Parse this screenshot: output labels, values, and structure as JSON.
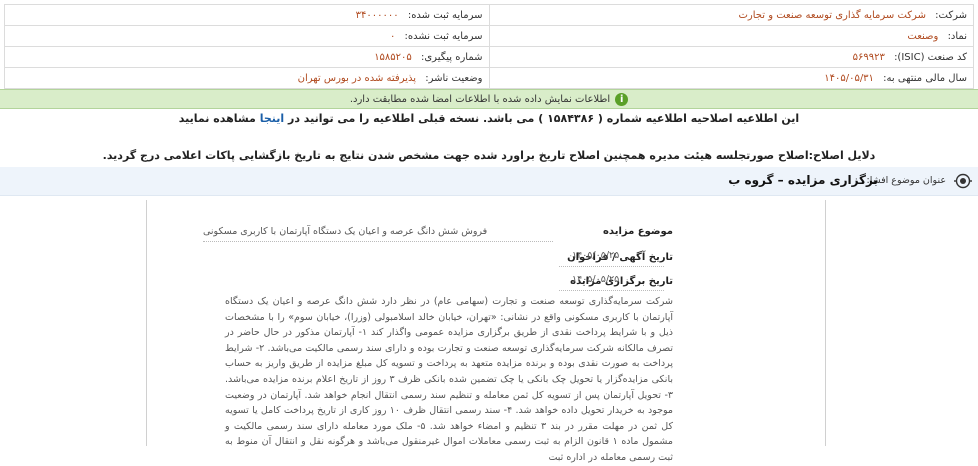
{
  "company_table": {
    "company_label": "شرکت:",
    "company_value": "شرکت سرمایه گذاری توسعه صنعت و تجارت",
    "registered_capital_label": "سرمایه ثبت شده:",
    "registered_capital_value": "۳۴۰۰۰۰۰۰",
    "symbol_label": "نماد:",
    "symbol_value": "وصنعت",
    "unregistered_capital_label": "سرمایه ثبت نشده:",
    "unregistered_capital_value": "۰",
    "isic_label": "کد صنعت (ISIC):",
    "isic_value": "۵۶۹۹۲۳",
    "tracking_label": "شماره پیگیری:",
    "tracking_value": "۱۵۸۵۲۰۵",
    "fiscal_label": "سال مالی منتهی به:",
    "fiscal_value": "۱۴۰۵/۰۵/۳۱",
    "status_label": "وضعیت ناشر:",
    "status_value": "پذیرفته شده در بورس تهران"
  },
  "notice": {
    "icon": "info-icon",
    "text": "اطلاعات نمایش داده شده با اطلاعات امضا شده مطابقت دارد."
  },
  "correction": {
    "line1_prefix": "این اطلاعیه اصلاحیه اطلاعیه شماره ( ۱۵۸۴۳۸۶ ) می باشد. نسخه قبلی اطلاعیه را می توانید در",
    "line1_link": "اینجا",
    "line1_suffix": "مشاهده نمایید",
    "line2": "دلایل اصلاح:اصلاح صورتجلسه هیئت مدیره همچنین اصلاح تاریخ براورد شده جهت مشخص شدن نتایج به تاریخ بازگشایی پاکات اعلامی درج گردید."
  },
  "subject": {
    "icon": "target-icon",
    "label": "عنوان موضوع افشا:",
    "title": "برگزاری مزایده – گروه ب"
  },
  "document": {
    "subject_label": "موضوع مزایده",
    "subject_value": "فروش شش دانگ عرصه و اعیان یک دستگاه آپارتمان با کاربری مسکونی",
    "ad_date_label": "تاریخ آگهی / فراخوان",
    "ad_date_value": "۱۴۰۵/۰۵/۲۵",
    "auction_date_label": "تاریخ برگزاری مزایده",
    "auction_date_value": "۱۴۰۵/۰۵/۲۵",
    "body": "شرکت سرمایه‌گذاری توسعه صنعت و تجارت (سهامی عام) در نظر دارد شش دانگ عرصه و اعیان یک دستگاه آپارتمان با کاربری مسکونی واقع در نشانی: «تهران، خیابان خالد اسلامبولی (وزرا)، خیابان سوم» را با مشخصات ذیل و با شرایط پرداخت نقدی از طریق برگزاری مزایده عمومی واگذار کند ۱- آپارتمان مذکور در حال حاضر در تصرف مالکانه شرکت سرمایه‌گذاری توسعه صنعت و تجارت بوده و دارای سند رسمی مالکیت می‌باشد. ۲- شرایط پرداخت به صورت نقدی بوده و برنده مزایده متعهد به پرداخت و تسویه کل مبلغ مزایده از طریق واریز به حساب بانکی مزایده‌گزار یا تحویل چک بانکی یا چک تضمین شده بانکی ظرف ۳ روز از تاریخ اعلام برنده مزایده می‌باشد. ۳- تحویل آپارتمان پس از تسویه کل ثمن معامله و تنظیم سند رسمی انتقال انجام خواهد شد. آپارتمان در وضعیت موجود به خریدار تحویل داده خواهد شد. ۴- سند رسمی انتقال ظرف ۱۰ روز کاری از تاریخ پرداخت کامل یا تسویه کل ثمن در مهلت مقرر در بند ۳ تنظیم و امضاء خواهد شد. ۵- ملک مورد معامله دارای سند رسمی مالکیت و مشمول ماده ۱ قانون الزام به ثبت رسمی معاملات اموال غیرمنقول می‌باشد و هرگونه نقل و انتقال آن منوط به ثبت رسمی معامله در اداره ثبت"
  }
}
